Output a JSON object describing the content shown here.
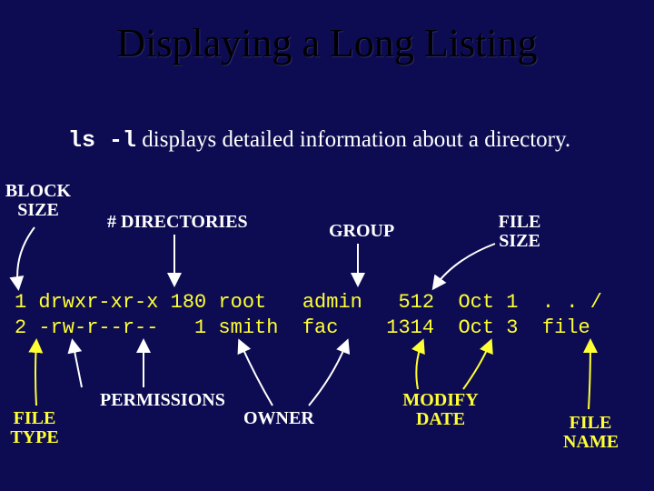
{
  "title": "Displaying a Long Listing",
  "desc_cmd": "ls -l",
  "desc_rest": " displays detailed information about a directory.",
  "labels": {
    "block_size": "BLOCK\nSIZE",
    "num_dirs": "# DIRECTORIES",
    "group": "GROUP",
    "file_size": "FILE\nSIZE",
    "file_type": "FILE\nTYPE",
    "permissions": "PERMISSIONS",
    "owner": "OWNER",
    "modify_date": "MODIFY\nDATE",
    "file_name": "FILE\nNAME"
  },
  "listing": {
    "row1": "1 drwxr-xr-x 180 root   admin   512  Oct 1  . . /",
    "row2": "2 -rw-r--r--   1 smith  fac    1314  Oct 3  file"
  }
}
